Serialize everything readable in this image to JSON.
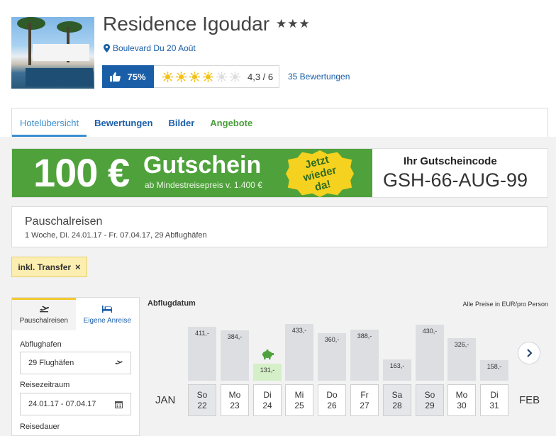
{
  "hotel": {
    "name": "Residence Igoudar",
    "stars": "★★★",
    "address": "Boulevard Du 20 Août",
    "recommendation": "75%",
    "suns_total": 6,
    "suns_filled": 4,
    "rating": "4,3 / 6",
    "reviews_link": "35 Bewertungen"
  },
  "tabs": [
    {
      "label": "Hotelübersicht"
    },
    {
      "label": "Bewertungen"
    },
    {
      "label": "Bilder"
    },
    {
      "label": "Angebote"
    }
  ],
  "banner": {
    "amount": "100 €",
    "word": "Gutschein",
    "subline": "ab Mindestreisepreis v. 1.400 €",
    "seal": "Jetzt wieder da!",
    "code_label": "Ihr Gutscheincode",
    "code": "GSH-66-AUG-99"
  },
  "package": {
    "title": "Pauschalreisen",
    "subtitle": "1 Woche, Di. 24.01.17 - Fr. 07.04.17, 29 Abflughäfen"
  },
  "filter_chip": {
    "label": "inkl. Transfer",
    "close": "×"
  },
  "sidebar": {
    "tabs": [
      {
        "label": "Pauschalreisen"
      },
      {
        "label": "Eigene Anreise"
      }
    ],
    "airports_label": "Abflughafen",
    "airports_value": "29 Flughäfen",
    "period_label": "Reisezeitraum",
    "period_value": "24.01.17 - 07.04.17",
    "duration_label": "Reisedauer"
  },
  "chart": {
    "title": "Abflugdatum",
    "note": "Alle Preise in EUR/pro Person",
    "month_left": "JAN",
    "month_right": "FEB"
  },
  "chart_data": {
    "type": "bar",
    "categories": [
      "So 22",
      "Mo 23",
      "Di 24",
      "Mi 25",
      "Do 26",
      "Fr 27",
      "Sa 28",
      "So 29",
      "Mo 30",
      "Di 31"
    ],
    "weekdays": [
      "So",
      "Mo",
      "Di",
      "Mi",
      "Do",
      "Fr",
      "Sa",
      "So",
      "Mo",
      "Di"
    ],
    "days": [
      "22",
      "23",
      "24",
      "25",
      "26",
      "27",
      "28",
      "29",
      "30",
      "31"
    ],
    "values": [
      411,
      384,
      131,
      433,
      360,
      388,
      163,
      430,
      326,
      158
    ],
    "labels": [
      "411,-",
      "384,-",
      "131,-",
      "433,-",
      "360,-",
      "388,-",
      "163,-",
      "430,-",
      "326,-",
      "158,-"
    ],
    "weekend": [
      true,
      false,
      false,
      false,
      false,
      false,
      true,
      true,
      false,
      false
    ],
    "best_index": 2,
    "colors": {
      "bar": "#dcdee2",
      "best": "#d5efc8",
      "piggy": "#4fa23b"
    }
  },
  "colors": {
    "brand_blue": "#1b5ea8",
    "green": "#4fa23b",
    "yellow": "#f5d21f"
  }
}
